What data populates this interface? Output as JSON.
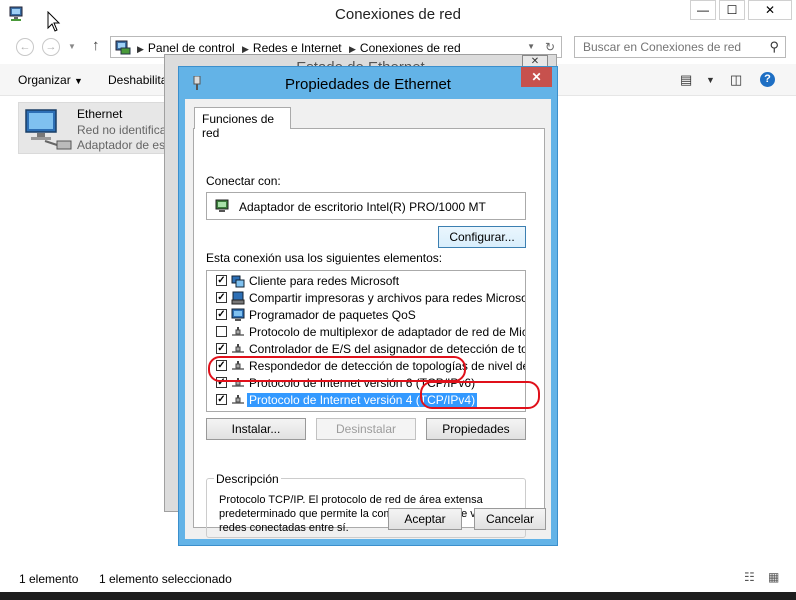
{
  "window": {
    "title": "Conexiones de red",
    "controls": {
      "minimize": "—",
      "maximize": "☐",
      "close": "✕"
    }
  },
  "address_bar": {
    "crumbs": [
      "Panel de control",
      "Redes e Internet",
      "Conexiones de red"
    ],
    "search_placeholder": "Buscar en Conexiones de red"
  },
  "toolbar": {
    "organize": "Organizar",
    "disable": "Deshabilita"
  },
  "file_item": {
    "name": "Ethernet",
    "status": "Red no identifica",
    "adapter": "Adaptador de es"
  },
  "status_bar": {
    "count": "1 elemento",
    "selected": "1 elemento seleccionado"
  },
  "background_dialog": {
    "title": "Estado de Ethernet"
  },
  "dialog": {
    "title": "Propiedades de Ethernet",
    "close": "✕",
    "tab": "Funciones de red",
    "connect_label": "Conectar con:",
    "adapter": "Adaptador de escritorio Intel(R) PRO/1000 MT",
    "configure_button": "Configurar...",
    "components_label": "Esta conexión usa los siguientes elementos:",
    "components": [
      {
        "label": "Cliente para redes Microsoft",
        "checked": true,
        "icon": "network-client-icon"
      },
      {
        "label": "Compartir impresoras y archivos para redes Microsoft",
        "checked": true,
        "icon": "printer-share-icon"
      },
      {
        "label": "Programador de paquetes QoS",
        "checked": true,
        "icon": "service-icon"
      },
      {
        "label": "Protocolo de multiplexor de adaptador de red de Microsoft",
        "checked": false,
        "icon": "protocol-icon"
      },
      {
        "label": "Controlador de E/S del asignador de detección de topol...",
        "checked": true,
        "icon": "protocol-icon"
      },
      {
        "label": "Respondedor de detección de topologías de nivel de v...",
        "checked": true,
        "icon": "protocol-icon"
      },
      {
        "label": "Protocolo de Internet versión 6 (TCP/IPv6)",
        "checked": true,
        "icon": "protocol-icon"
      },
      {
        "label": "Protocolo de Internet versión 4 (TCP/IPv4)",
        "checked": true,
        "icon": "protocol-icon",
        "selected": true
      }
    ],
    "install_button": "Instalar...",
    "uninstall_button": "Desinstalar",
    "properties_button": "Propiedades",
    "description_title": "Descripción",
    "description": "Protocolo TCP/IP. El protocolo de red de área extensa predeterminado que permite la comunicación entre varias redes conectadas entre sí.",
    "ok_button": "Aceptar",
    "cancel_button": "Cancelar"
  },
  "colors": {
    "dialog_frame": "#63b3e7",
    "close_button": "#c7514d",
    "selection": "#3399ff",
    "annotation": "#e0101a"
  }
}
